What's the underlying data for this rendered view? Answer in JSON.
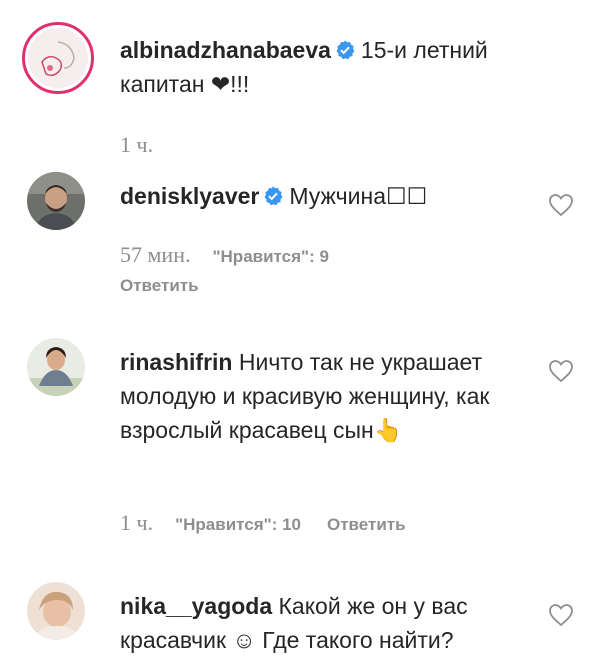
{
  "post_caption": {
    "username": "albinadzhanabaeva",
    "text": "15-и летний капитан ❤!!!",
    "time": "1 ч."
  },
  "comments": [
    {
      "username": "denisklyaver",
      "verified": true,
      "text": "Мужчина☐☐",
      "time": "57 мин.",
      "likes": "\"Нравится\": 9",
      "reply": "Ответить"
    },
    {
      "username": "rinashifrin",
      "verified": false,
      "text": "Ничто так не украшает молодую и красивую женщину, как взрослый красавец сын👆",
      "time": "1 ч.",
      "likes": "\"Нравится\": 10",
      "reply": "Ответить"
    },
    {
      "username": "nika__yagoda",
      "verified": false,
      "text": "Какой же он у вас красавчик ☺ Где такого найти?"
    }
  ],
  "icons": {
    "like": "heart-outline-icon",
    "verified": "verified-badge-icon"
  },
  "colors": {
    "verified_blue": "#3897f0",
    "meta_gray": "#8e8e8e",
    "text": "#262626",
    "story_ring": "#e1306c"
  }
}
